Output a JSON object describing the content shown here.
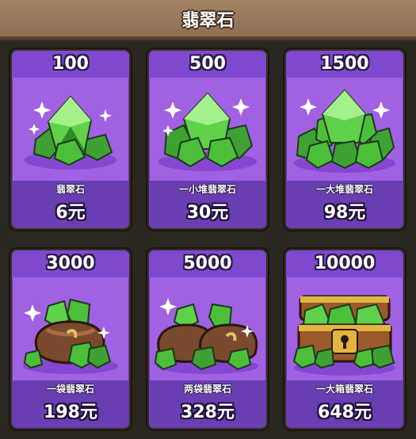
{
  "header": {
    "title": "翡翠石"
  },
  "colors": {
    "card_purple": "#a061e2",
    "band_purple": "#6a3eb3",
    "emerald": "#4cbf3a",
    "frame": "#3a2f24"
  },
  "shop": {
    "items": [
      {
        "amount": "100",
        "name": "翡翠石",
        "price": "6元",
        "icon": "emerald-small-pile-icon"
      },
      {
        "amount": "500",
        "name": "一小堆翡翠石",
        "price": "30元",
        "icon": "emerald-pile-icon"
      },
      {
        "amount": "1500",
        "name": "一大堆翡翠石",
        "price": "98元",
        "icon": "emerald-large-pile-icon"
      },
      {
        "amount": "3000",
        "name": "一袋翡翠石",
        "price": "198元",
        "icon": "emerald-bag-icon"
      },
      {
        "amount": "5000",
        "name": "两袋翡翠石",
        "price": "328元",
        "icon": "emerald-two-bags-icon"
      },
      {
        "amount": "10000",
        "name": "一大箱翡翠石",
        "price": "648元",
        "icon": "emerald-chest-icon"
      }
    ]
  }
}
